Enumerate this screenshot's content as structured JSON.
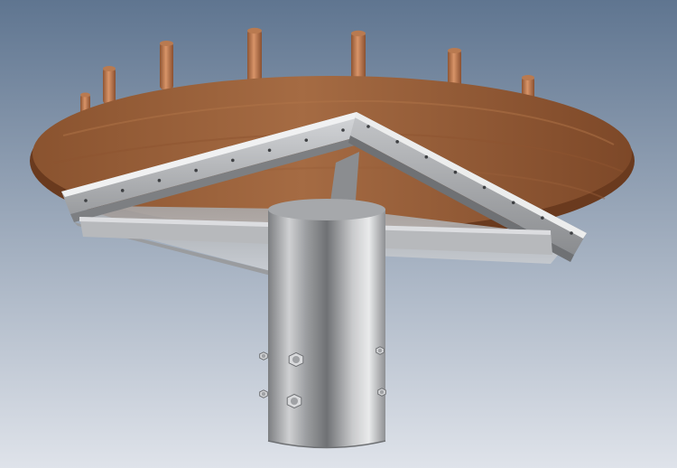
{
  "scene": {
    "subject": "cad-render",
    "colors": {
      "bg_top": "#5f7590",
      "bg_bottom": "#dfe3ea",
      "wood_light": "#a56b43",
      "wood_dark": "#7a4525",
      "wood_edge": "#6a3a1e",
      "pin": "#c0825a",
      "steel_light": "#e8e9eb",
      "steel_mid": "#b3b5b8",
      "steel_dark": "#6f7174",
      "bolt": "#d9dadc"
    }
  }
}
